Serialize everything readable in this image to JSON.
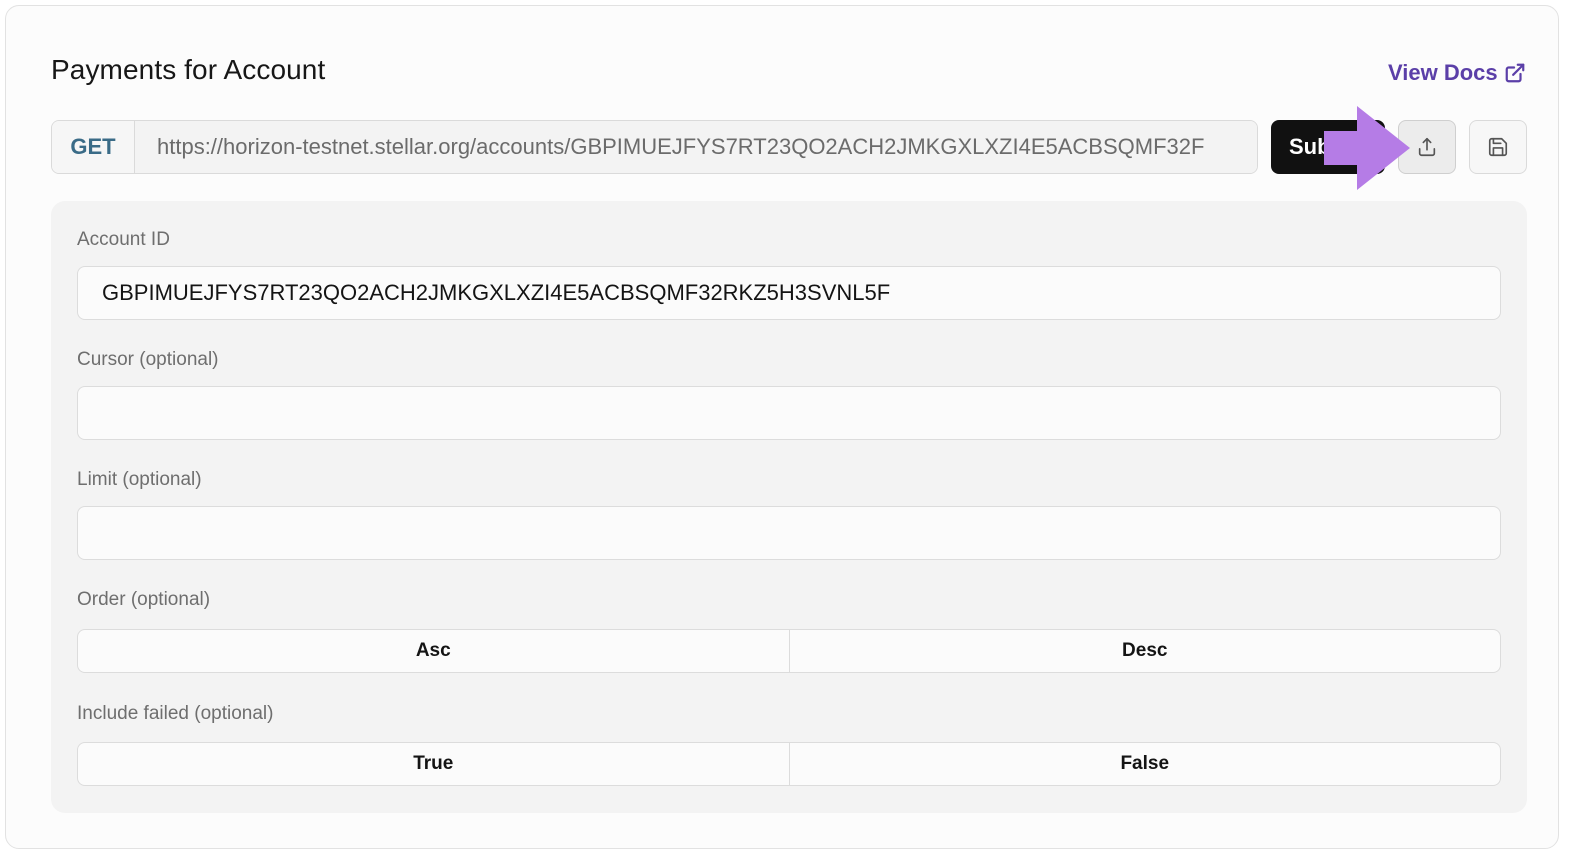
{
  "page": {
    "title": "Payments for Account",
    "view_docs_label": "View Docs"
  },
  "request": {
    "method": "GET",
    "url": "https://horizon-testnet.stellar.org/accounts/GBPIMUEJFYS7RT23QO2ACH2JMKGXLXZI4E5ACBSQMF32F",
    "submit_label": "Sub",
    "share_icon": "share-upload-icon",
    "save_icon": "save-floppy-icon"
  },
  "form": {
    "account_id": {
      "label": "Account ID",
      "value": "GBPIMUEJFYS7RT23QO2ACH2JMKGXLXZI4E5ACBSQMF32RKZ5H3SVNL5F"
    },
    "cursor": {
      "label": "Cursor (optional)",
      "value": ""
    },
    "limit": {
      "label": "Limit (optional)",
      "value": ""
    },
    "order": {
      "label": "Order (optional)",
      "options": [
        "Asc",
        "Desc"
      ]
    },
    "include_failed": {
      "label": "Include failed (optional)",
      "options": [
        "True",
        "False"
      ]
    }
  },
  "colors": {
    "accent_link": "#5b3fa8",
    "method": "#3a6b87",
    "annotation_arrow": "#b57ce6"
  }
}
